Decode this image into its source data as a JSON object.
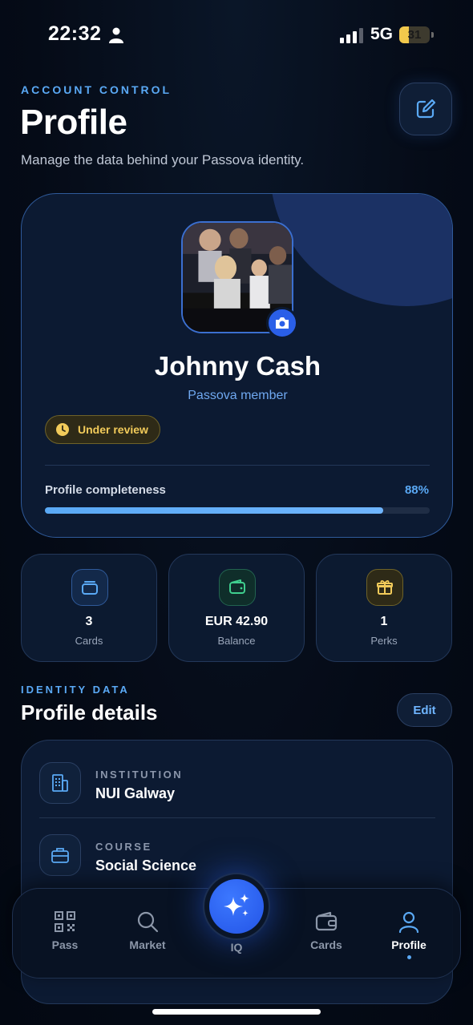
{
  "status_bar": {
    "time": "22:32",
    "network": "5G",
    "battery_level": "31",
    "battery_fraction": 0.31
  },
  "header": {
    "eyebrow": "ACCOUNT CONTROL",
    "title": "Profile",
    "subtitle": "Manage the data behind your Passova identity.",
    "edit_icon": "edit-square-icon"
  },
  "profile": {
    "name": "Johnny Cash",
    "role": "Passova member",
    "status_badge": "Under review",
    "completeness_label": "Profile completeness",
    "completeness_value": "88%",
    "completeness_fraction": 0.88
  },
  "stats": [
    {
      "value": "3",
      "label": "Cards",
      "icon": "cards-stack-icon",
      "color": "#5aa9f5"
    },
    {
      "value": "EUR 42.90",
      "label": "Balance",
      "icon": "wallet-icon",
      "color": "#3fcf8e"
    },
    {
      "value": "1",
      "label": "Perks",
      "icon": "gift-icon",
      "color": "#f2cb5a"
    }
  ],
  "identity": {
    "eyebrow": "IDENTITY DATA",
    "title": "Profile details",
    "edit_label": "Edit",
    "rows": [
      {
        "key": "INSTITUTION",
        "value": "NUI Galway",
        "icon": "building-icon"
      },
      {
        "key": "COURSE",
        "value": "Social Science",
        "icon": "briefcase-icon"
      }
    ]
  },
  "tabbar": {
    "tabs": [
      {
        "label": "Pass",
        "icon": "qr-code-icon"
      },
      {
        "label": "Market",
        "icon": "search-icon"
      },
      {
        "label": "IQ",
        "icon": "sparkles-icon"
      },
      {
        "label": "Cards",
        "icon": "wallet-icon"
      },
      {
        "label": "Profile",
        "icon": "person-icon"
      }
    ],
    "active": "Profile"
  },
  "colors": {
    "accent": "#5aa9f5",
    "warning": "#f2cb5a",
    "success": "#3fcf8e",
    "primary_button": "#2a5fe8"
  }
}
